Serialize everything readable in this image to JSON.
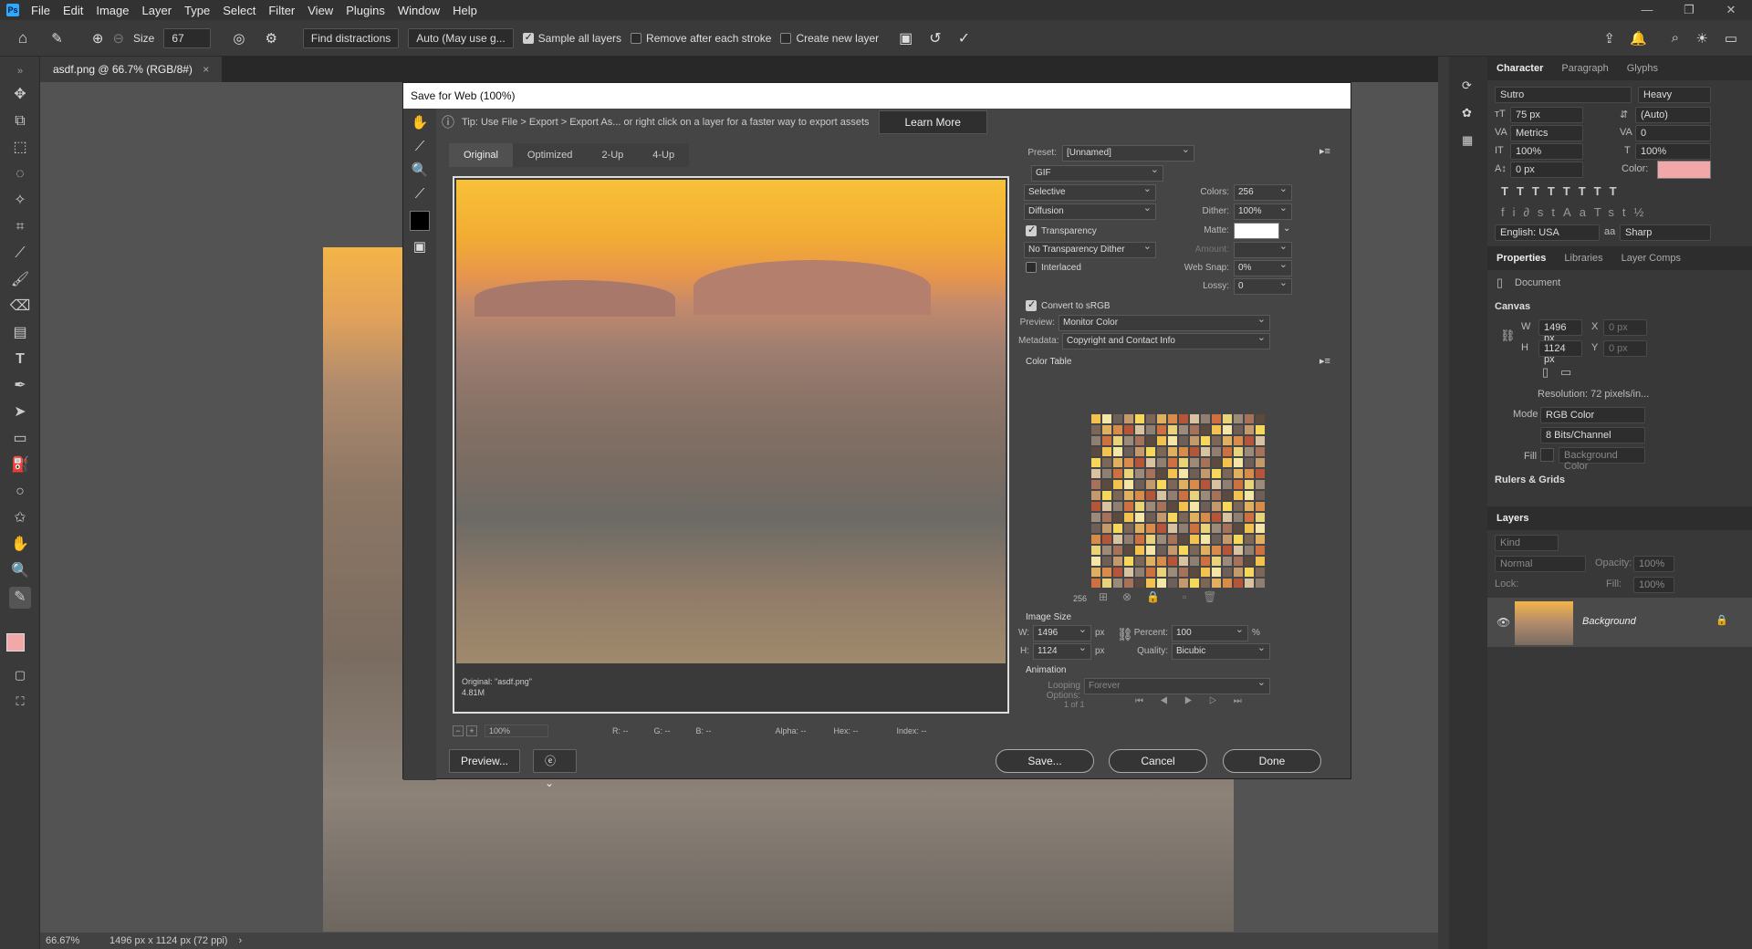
{
  "menubar": {
    "app_icon": "Ps",
    "items": [
      "File",
      "Edit",
      "Image",
      "Layer",
      "Type",
      "Select",
      "Filter",
      "View",
      "Plugins",
      "Window",
      "Help"
    ]
  },
  "options": {
    "size_label": "Size",
    "size_value": "67",
    "find_distractions": "Find distractions",
    "auto_mode": "Auto (May use g...",
    "sample_all_layers": "Sample all layers",
    "remove_after_stroke": "Remove after each stroke",
    "create_new_layer": "Create new layer"
  },
  "document": {
    "tab_title": "asdf.png @ 66.7% (RGB/8#)"
  },
  "statusbar": {
    "zoom": "66.67%",
    "info": "1496 px x 1124 px (72 ppi)"
  },
  "dialog": {
    "title": "Save for Web (100%)",
    "tip": "Tip: Use File > Export > Export As...  or right click on a layer for a faster way to export assets",
    "learn_more": "Learn More",
    "view_tabs": [
      "Original",
      "Optimized",
      "2-Up",
      "4-Up"
    ],
    "active_tab": "Original",
    "preview_caption_1": "Original: \"asdf.png\"",
    "preview_caption_2": "4.81M",
    "zoom_value": "100%",
    "readouts": {
      "r": "R: --",
      "g": "G: --",
      "b": "B: --",
      "alpha": "Alpha: --",
      "hex": "Hex: --",
      "index": "Index: --"
    },
    "preview_button": "Preview...",
    "save_button": "Save...",
    "cancel_button": "Cancel",
    "done_button": "Done",
    "preset_label": "Preset:",
    "preset_value": "[Unnamed]",
    "format": "GIF",
    "reduction": "Selective",
    "dither_algo": "Diffusion",
    "transparency_label": "Transparency",
    "transparency_dither": "No Transparency Dither",
    "interlaced_label": "Interlaced",
    "colors_label": "Colors:",
    "colors_value": "256",
    "dither_label": "Dither:",
    "dither_value": "100%",
    "matte_label": "Matte:",
    "amount_label": "Amount:",
    "websnap_label": "Web Snap:",
    "websnap_value": "0%",
    "lossy_label": "Lossy:",
    "lossy_value": "0",
    "convert_srgb": "Convert to sRGB",
    "preview_label": "Preview:",
    "preview_value": "Monitor Color",
    "metadata_label": "Metadata:",
    "metadata_value": "Copyright and Contact Info",
    "color_table_label": "Color Table",
    "color_count": "256",
    "image_size_label": "Image Size",
    "w_label": "W:",
    "w_value": "1496",
    "h_label": "H:",
    "h_value": "1124",
    "px": "px",
    "percent_label": "Percent:",
    "percent_value": "100",
    "percent_unit": "%",
    "quality_label": "Quality:",
    "quality_value": "Bicubic",
    "animation_label": "Animation",
    "looping_label": "Looping Options:",
    "looping_value": "Forever",
    "frame_counter": "1 of 1"
  },
  "character": {
    "tabs": [
      "Character",
      "Paragraph",
      "Glyphs"
    ],
    "font_family": "Sutro",
    "font_style": "Heavy",
    "font_size": "75 px",
    "leading": "(Auto)",
    "kerning": "Metrics",
    "tracking": "0",
    "vscale": "100%",
    "hscale": "100%",
    "baseline": "0 px",
    "color_label": "Color:",
    "color_value": "#f2a8a8",
    "language": "English: USA",
    "antialias": "Sharp"
  },
  "properties": {
    "tabs": [
      "Properties",
      "Libraries",
      "Layer Comps"
    ],
    "document_label": "Document",
    "canvas_label": "Canvas",
    "w_label": "W",
    "w_value": "1496 px",
    "x_label": "X",
    "x_placeholder": "0 px",
    "h_label": "H",
    "h_value": "1124 px",
    "y_label": "Y",
    "y_placeholder": "0 px",
    "resolution": "Resolution: 72 pixels/in...",
    "mode_label": "Mode",
    "mode_value": "RGB Color",
    "bits_value": "8 Bits/Channel",
    "fill_label": "Fill",
    "fill_value": "Background Color",
    "rulers_label": "Rulers & Grids"
  },
  "layers": {
    "title": "Layers",
    "kind": "Kind",
    "blend": "Normal",
    "opacity_label": "Opacity:",
    "opacity_value": "100%",
    "lock_label": "Lock:",
    "fill_label": "Fill:",
    "fill_value": "100%",
    "layer_name": "Background"
  },
  "colors": {
    "accent": "#31a8ff",
    "foreground_swatch": "#f2a8a8",
    "background_swatch": "#ffffff"
  }
}
